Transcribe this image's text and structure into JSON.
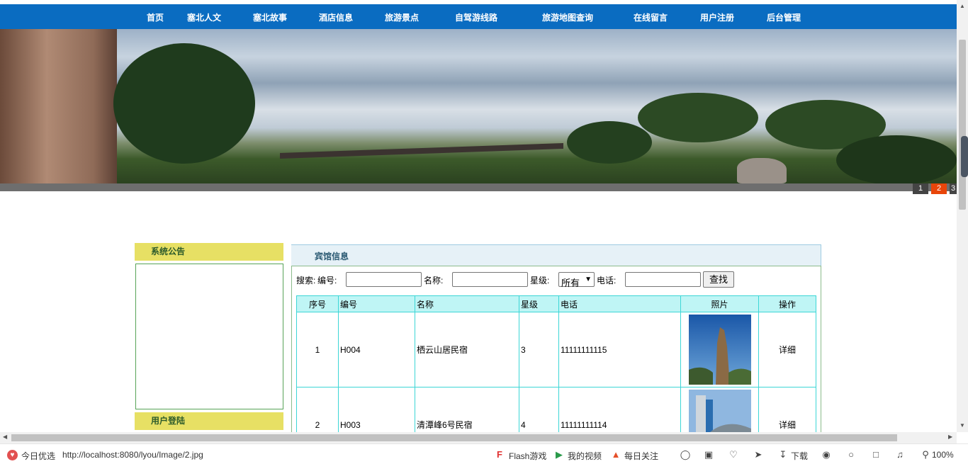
{
  "nav": {
    "items": [
      "首页",
      "塞北人文",
      "塞北故事",
      "酒店信息",
      "旅游景点",
      "自驾游线路",
      "旅游地图查询",
      "在线留言",
      "用户注册",
      "后台管理"
    ]
  },
  "banner": {
    "pager": [
      "1",
      "2",
      "3"
    ],
    "active_page": "2"
  },
  "sidebar": {
    "notice_title": "系统公告",
    "login_title": "用户登陆"
  },
  "hotel": {
    "title": "宾馆信息",
    "search": {
      "label_search": "搜索:",
      "label_code": "编号:",
      "label_name": "名称:",
      "label_star": "星级:",
      "star_selected": "所有",
      "label_phone": "电话:",
      "button": "查找",
      "code_value": "",
      "name_value": "",
      "phone_value": ""
    },
    "columns": [
      "序号",
      "编号",
      "名称",
      "星级",
      "电话",
      "照片",
      "操作"
    ],
    "rows": [
      {
        "index": "1",
        "code": "H004",
        "name": "栖云山居民宿",
        "star": "3",
        "phone": "11111111115",
        "action": "详细"
      },
      {
        "index": "2",
        "code": "H003",
        "name": "清潭峰6号民宿",
        "star": "4",
        "phone": "11111111114",
        "action": "详细"
      }
    ]
  },
  "statusbar": {
    "today_pick": "今日优选",
    "url": "http://localhost:8080/lyou/Image/2.jpg",
    "flash_games": "Flash游戏",
    "my_videos": "我的视频",
    "daily_focus": "每日关注",
    "download": "下载",
    "zoom": "100%"
  },
  "colors": {
    "nav_bg": "#0a6cc1",
    "panel_head_bg": "#e7e064",
    "table_border": "#3cd6d6",
    "table_head_bg": "#bff5f5",
    "pager_active": "#e8450a"
  }
}
